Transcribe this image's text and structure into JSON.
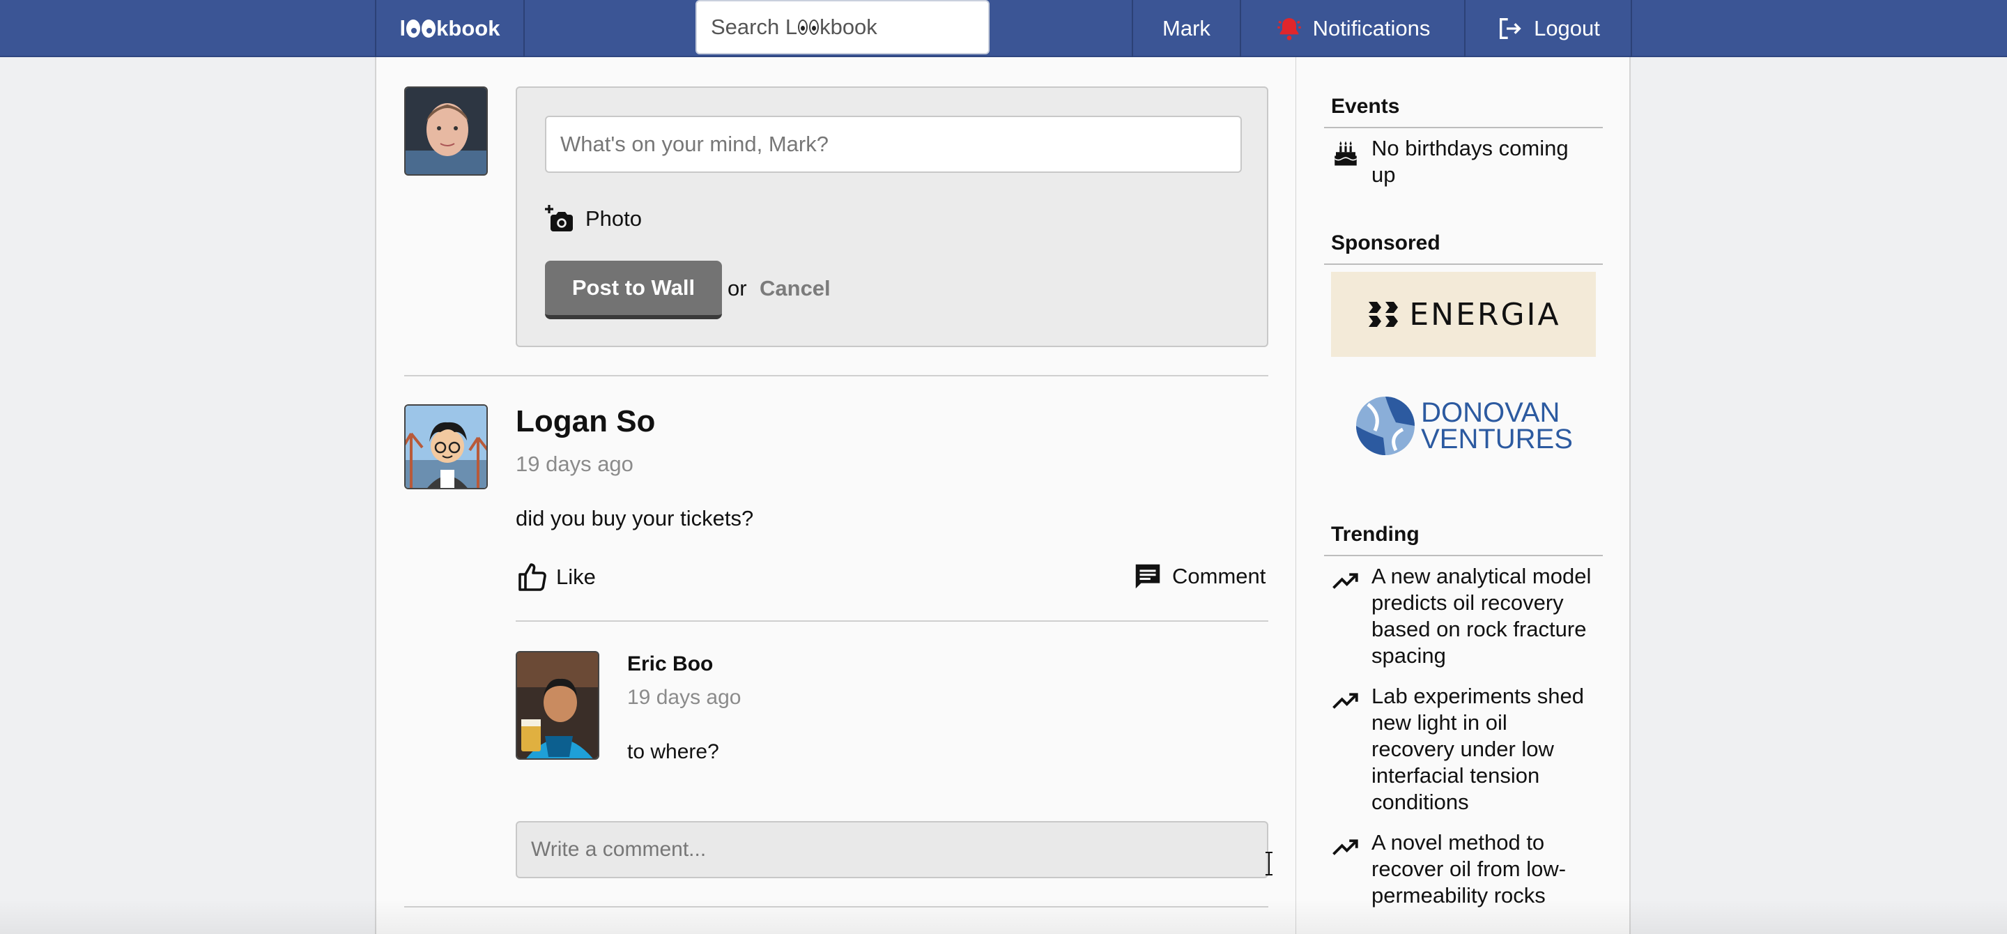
{
  "brand": {
    "logo_prefix": "l",
    "logo_suffix": "kbook"
  },
  "nav": {
    "search_placeholder_prefix": "Search L",
    "search_placeholder_suffix": "kbook",
    "user_label": "Mark",
    "notifications_label": "Notifications",
    "logout_label": "Logout"
  },
  "composer": {
    "placeholder": "What's on your mind, Mark?",
    "photo_label": "Photo",
    "post_button": "Post to Wall",
    "or_text": "or",
    "cancel_label": "Cancel"
  },
  "post": {
    "author": "Logan So",
    "time": "19 days ago",
    "text": "did you buy your tickets?",
    "like_label": "Like",
    "comment_label": "Comment",
    "comments": [
      {
        "author": "Eric Boo",
        "time": "19 days ago",
        "text": "to where?"
      }
    ],
    "comment_placeholder": "Write a comment..."
  },
  "sidebar": {
    "events_title": "Events",
    "events_item": "No birthdays coming up",
    "sponsored_title": "Sponsored",
    "sponsors": [
      {
        "name": "ENERGIA"
      },
      {
        "name_line1": "DONOVAN",
        "name_line2": "VENTURES"
      }
    ],
    "trending_title": "Trending",
    "trending": [
      "A new analytical model predicts oil recovery based on rock fracture spacing",
      "Lab experiments shed new light in oil recovery under low interfacial tension conditions",
      "A novel method to recover oil from low-permeability rocks"
    ]
  },
  "colors": {
    "topbar": "#3b5595",
    "notification_icon": "#e0262b",
    "energia_bg": "#f3ead8",
    "donovan_blue": "#2c5aa0"
  }
}
